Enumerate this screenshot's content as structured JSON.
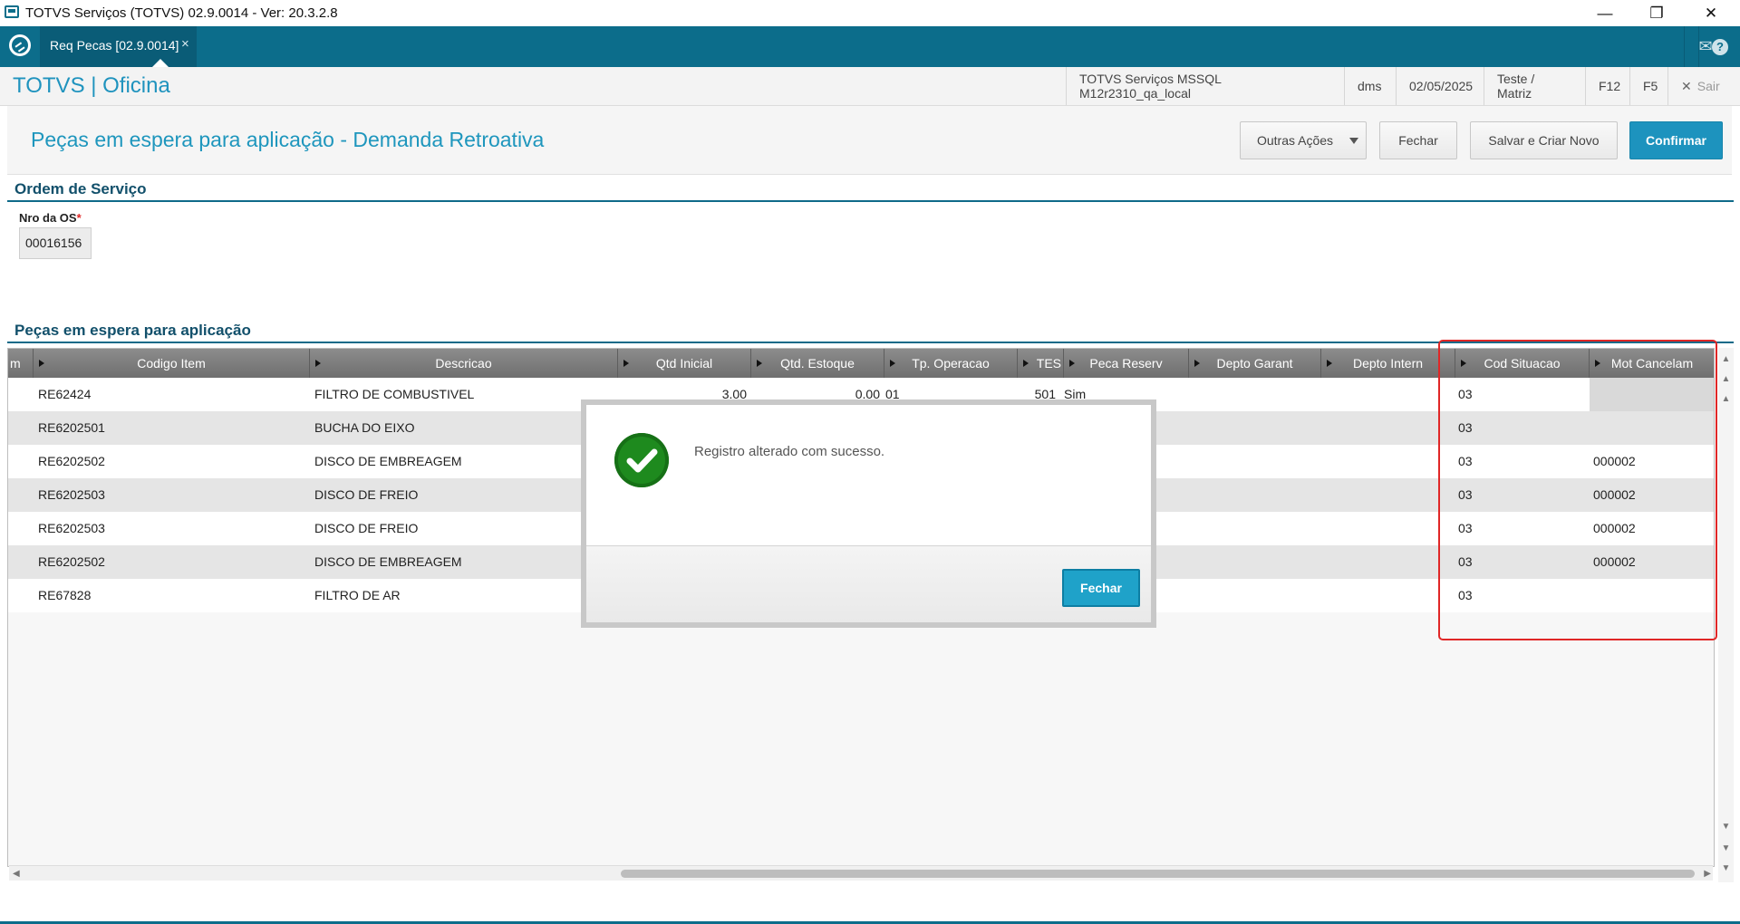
{
  "window": {
    "title": "TOTVS Serviços (TOTVS) 02.9.0014 - Ver: 20.3.2.8",
    "minimize": "—",
    "restore": "❐",
    "close": "✕"
  },
  "tabbar": {
    "tab_label": "Req Pecas [02.9.0014]",
    "tab_close": "×",
    "mail_icon": "✉",
    "help_icon": "?"
  },
  "header": {
    "brand": "TOTVS | Oficina",
    "environment": "TOTVS Serviços MSSQL M12r2310_qa_local",
    "module": "dms",
    "date": "02/05/2025",
    "company": "Teste / Matriz",
    "f12": "F12",
    "f5": "F5",
    "exit_icon": "✕",
    "exit_label": "Sair"
  },
  "page": {
    "title": "Peças em espera para aplicação - Demanda Retroativa",
    "buttons": {
      "outras_acoes": "Outras Ações",
      "fechar": "Fechar",
      "salvar_criar": "Salvar e Criar Novo",
      "confirmar": "Confirmar"
    }
  },
  "ordem": {
    "section_title": "Ordem de Serviço",
    "field_label": "Nro da OS",
    "required_mark": "*",
    "field_value": "00016156"
  },
  "pecas": {
    "section_title": "Peças em espera para aplicação",
    "columns": [
      "m",
      "Codigo Item",
      "Descricao",
      "Qtd Inicial",
      "Qtd. Estoque",
      "Tp. Operacao",
      "TES",
      "Peca Reserv",
      "Depto Garant",
      "Depto Intern",
      "Cod Situacao",
      "Mot Cancelam"
    ],
    "rows": [
      {
        "codigo": "RE62424",
        "descricao": "FILTRO DE COMBUSTIVEL",
        "qtd_inicial": "3.00",
        "qtd_estoque": "0.00",
        "tp_operacao": "01",
        "tes": "501",
        "peca_reserv": "Sim",
        "cod_situacao": "03",
        "mot_cancelam": ""
      },
      {
        "codigo": "RE6202501",
        "descricao": "BUCHA DO EIXO",
        "qtd_inicial": "",
        "qtd_estoque": "",
        "tp_operacao": "",
        "tes": "",
        "peca_reserv": "",
        "cod_situacao": "03",
        "mot_cancelam": ""
      },
      {
        "codigo": "RE6202502",
        "descricao": "DISCO DE EMBREAGEM",
        "qtd_inicial": "",
        "qtd_estoque": "",
        "tp_operacao": "",
        "tes": "",
        "peca_reserv": "",
        "cod_situacao": "03",
        "mot_cancelam": "000002"
      },
      {
        "codigo": "RE6202503",
        "descricao": "DISCO DE FREIO",
        "qtd_inicial": "",
        "qtd_estoque": "",
        "tp_operacao": "",
        "tes": "",
        "peca_reserv": "",
        "cod_situacao": "03",
        "mot_cancelam": "000002"
      },
      {
        "codigo": "RE6202503",
        "descricao": "DISCO DE FREIO",
        "qtd_inicial": "",
        "qtd_estoque": "",
        "tp_operacao": "",
        "tes": "",
        "peca_reserv": "",
        "cod_situacao": "03",
        "mot_cancelam": "000002"
      },
      {
        "codigo": "RE6202502",
        "descricao": "DISCO DE EMBREAGEM",
        "qtd_inicial": "",
        "qtd_estoque": "",
        "tp_operacao": "",
        "tes": "",
        "peca_reserv": "",
        "cod_situacao": "03",
        "mot_cancelam": "000002"
      },
      {
        "codigo": "RE67828",
        "descricao": "FILTRO DE AR",
        "qtd_inicial": "",
        "qtd_estoque": "",
        "tp_operacao": "",
        "tes": "",
        "peca_reserv": "",
        "cod_situacao": "03",
        "mot_cancelam": ""
      }
    ]
  },
  "modal": {
    "message": "Registro alterado com sucesso.",
    "button": "Fechar",
    "icon": "✔"
  },
  "colors": {
    "accent": "#1d93be",
    "tabbar": "#0c6d8b",
    "highlight": "#e02727",
    "success": "#1e8a1e"
  }
}
